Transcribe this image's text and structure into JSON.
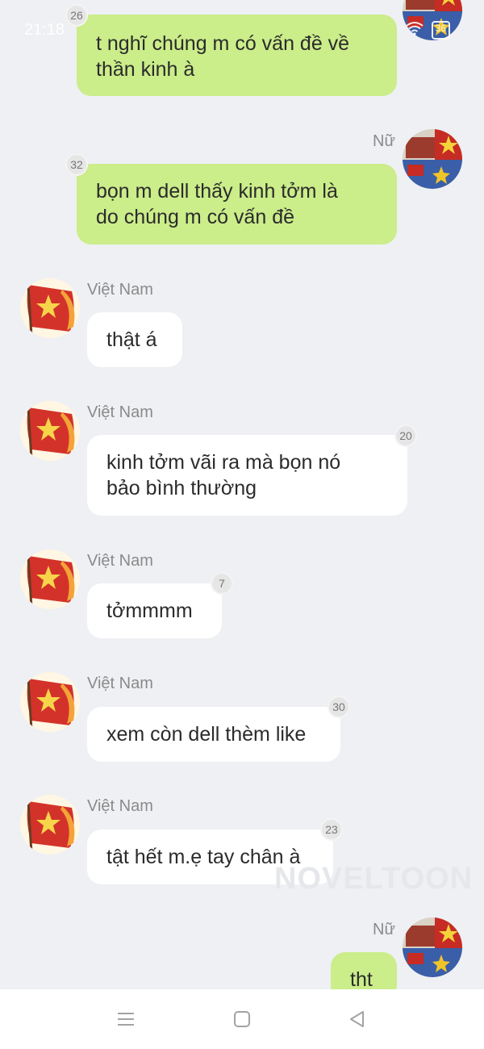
{
  "status_bar": {
    "time": "21:18",
    "battery": "36"
  },
  "messages": [
    {
      "side": "right",
      "sender": "",
      "count": "26",
      "lines": [
        "t nghĩ chúng m có vấn đề về",
        "thần kinh à"
      ]
    },
    {
      "side": "right",
      "sender": "Nữ",
      "count": "32",
      "lines": [
        "bọn m dell thấy kinh tởm là",
        "do chúng m có vấn đề"
      ]
    },
    {
      "side": "left",
      "sender": "Việt Nam",
      "count": "",
      "lines": [
        "thật á"
      ]
    },
    {
      "side": "left",
      "sender": "Việt Nam",
      "count": "20",
      "lines": [
        "kinh tởm vãi ra mà bọn nó",
        "bảo bình thường"
      ]
    },
    {
      "side": "left",
      "sender": "Việt Nam",
      "count": "7",
      "lines": [
        "tởmmmm"
      ]
    },
    {
      "side": "left",
      "sender": "Việt Nam",
      "count": "30",
      "lines": [
        "xem còn dell thèm like"
      ]
    },
    {
      "side": "left",
      "sender": "Việt Nam",
      "count": "23",
      "lines": [
        "tật hết m.ẹ tay chân à"
      ]
    },
    {
      "side": "right",
      "sender": "Nữ",
      "count": "",
      "lines": [
        "tht"
      ]
    }
  ],
  "watermark": "NOVELTOON",
  "nav": {
    "menu_icon": "menu-icon",
    "home_icon": "square-home-icon",
    "back_icon": "triangle-back-icon"
  },
  "colors": {
    "my_bubble": "#cbed8a",
    "other_bubble": "#ffffff",
    "background": "#eef0f3"
  }
}
